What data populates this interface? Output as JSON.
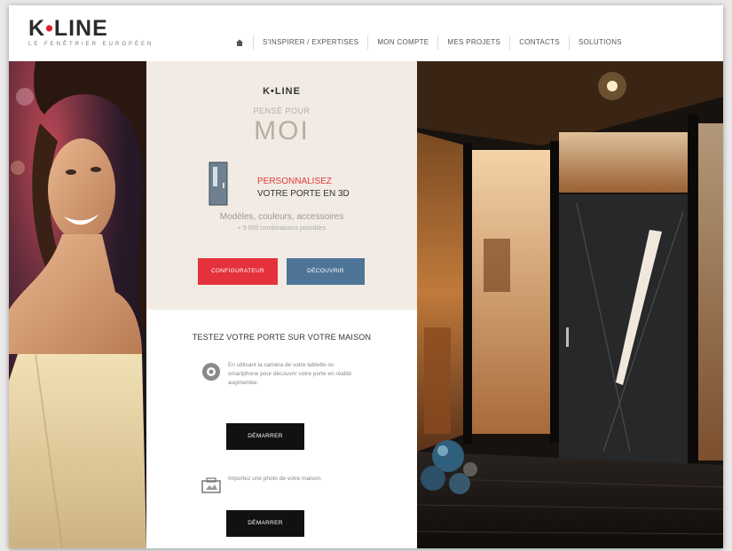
{
  "header": {
    "logo_main_left": "K",
    "logo_dot": "•",
    "logo_main_right": "LINE",
    "logo_tagline": "LE FENÊTRIER EUROPÉEN",
    "nav": [
      {
        "label": "S'INSPIRER / EXPERTISES"
      },
      {
        "label": "MON COMPTE"
      },
      {
        "label": "MES PROJETS"
      },
      {
        "label": "CONTACTS"
      },
      {
        "label": "SOLUTIONS"
      }
    ]
  },
  "promo": {
    "brand": "K•LINE",
    "kicker": "PENSÉ POUR",
    "big": "MOI",
    "title_line1": "PERSONNALISEZ",
    "title_line2": "VOTRE PORTE EN 3D",
    "sub_line1": "Modèles, couleurs, accessoires",
    "sub_line2": "+ 5 000 combinaisons possibles",
    "btn_configure": "CONFIGURATEUR",
    "btn_discover": "DÉCOUVRIR"
  },
  "test": {
    "title": "TESTEZ VOTRE PORTE SUR VOTRE MAISON",
    "feature1_text": "En utilisant la caméra de votre tablette ou smartphone pour découvrir votre porte en réalité augmentée.",
    "feature1_button": "DÉMARRER",
    "feature2_text": "Importez une photo de votre maison.",
    "feature2_button": "DÉMARRER"
  },
  "colors": {
    "brand_red": "#e5313c",
    "brand_blue": "#4e7598",
    "promo_bg": "#f1ebe4"
  },
  "icons": {
    "home": "home-icon",
    "camera": "camera-icon",
    "upload": "upload-photo-icon"
  }
}
